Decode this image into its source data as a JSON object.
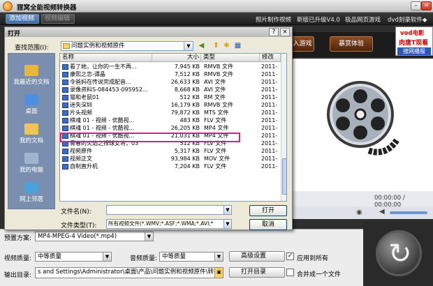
{
  "app": {
    "title": "狸窝全能视频转换器",
    "minimize_glyph": "–",
    "close_glyph": "×"
  },
  "toolbar": {
    "add_video": "添加视频",
    "edit_video": "视频编辑",
    "links": [
      "照片制作视频",
      "新版已升级V4.0",
      "极品网页游戏",
      "dvd刻录软件◆"
    ]
  },
  "banner": {
    "enter_game": "入游戏",
    "storm_experience": "暴赏体验",
    "vod_title": "vod电影",
    "vod_slogan": "肉唐T观看",
    "vod_sub": "搜网播服"
  },
  "preview": {
    "time_text": "00:00:00 / 00:00:00",
    "camera_icon": "camera-icon",
    "volume_icon": "volume-icon",
    "volume_level": 0.75
  },
  "settings": {
    "preset_label": "预置方案:",
    "preset_value": "MP4-MPEG-4 Video(*.mp4)",
    "video_quality_label": "视频质量:",
    "video_quality_value": "中等质量",
    "audio_quality_label": "音频质量:",
    "audio_quality_value": "中等质量",
    "advanced_label": "高级设置",
    "apply_all_label": "应用到所有",
    "apply_all_checked": true,
    "output_label": "输出目录:",
    "output_value": "s and Settings\\Administrator\\桌面\\产品\\问题实例和视频原件\\转换",
    "open_dir_label": "打开目录",
    "merge_label": "合并成一个文件",
    "merge_checked": false
  },
  "dialog": {
    "title": "打开",
    "help_glyph": "?",
    "close_glyph": "×",
    "lookin_label": "查找范围(I):",
    "lookin_value": "问题实例和视频原件",
    "places": [
      {
        "label": "我最近的文档",
        "color": "#e8b640"
      },
      {
        "label": "桌面",
        "color": "#4f8fe0"
      },
      {
        "label": "我的文档",
        "color": "#f1c555"
      },
      {
        "label": "我的电脑",
        "color": "#9fb4cf"
      },
      {
        "label": "网上邻居",
        "color": "#4aa2d8"
      }
    ],
    "columns": {
      "name": "名称",
      "size": "大小",
      "type": "类型",
      "modified": "修改"
    },
    "files": [
      {
        "name": "看了她，让你的一生不再...",
        "size": "7,945 KB",
        "type": "RMVB 文件",
        "mod": "2011-"
      },
      {
        "name": "康熙之恋-谭晶",
        "size": "7,512 KB",
        "type": "RMVB 文件",
        "mod": "2011-"
      },
      {
        "name": "令爸妈在传说完成配音...",
        "size": "26,633 KB",
        "type": "AVI 文件",
        "mod": "2011-"
      },
      {
        "name": "录像资料S-084453-095952...",
        "size": "8,668 KB",
        "type": "AVI 文件",
        "mod": "2011-"
      },
      {
        "name": "猫和老鼠01",
        "size": "512 KB",
        "type": "RM 文件",
        "mod": "2011-"
      },
      {
        "name": "迷失深圳",
        "size": "16,179 KB",
        "type": "RMVB 文件",
        "mod": "2011-"
      },
      {
        "name": "片头视频",
        "size": "79,872 KB",
        "type": "MTS 文件",
        "mod": "2011-"
      },
      {
        "name": "棋魂 01 - 视频 - 优酷视...",
        "size": "483 KB",
        "type": "FLV 文件",
        "mod": "2011-"
      },
      {
        "name": "棋魂 01 - 视频 - 优酷视...",
        "size": "26,205 KB",
        "type": "MP4 文件",
        "mod": "2011-"
      },
      {
        "name": "棋魂 01 - 视频 - 优酷视...",
        "size": "21,031 KB",
        "type": "MP4 文件",
        "mod": "2011-"
      },
      {
        "name": "青春的火焰之择球女将，03",
        "size": "512 KB",
        "type": "FLV 文件",
        "mod": "2011-"
      },
      {
        "name": "视频原件",
        "size": "5,317 KB",
        "type": "FLV 文件",
        "mod": "2011-"
      },
      {
        "name": "视频正文",
        "size": "93,984 KB",
        "type": "MOV 文件",
        "mod": "2011-"
      },
      {
        "name": "自制直升机",
        "size": "7,204 KB",
        "type": "FLV 文件",
        "mod": "2011-"
      }
    ],
    "filename_label": "文件名(N):",
    "filename_value": "",
    "filetype_label": "文件类型(T):",
    "filetype_value": "所有视频文件(*.WMV;*.ASF;*.WMA;*.AVI;*",
    "open_label": "打开",
    "cancel_label": "取消"
  }
}
